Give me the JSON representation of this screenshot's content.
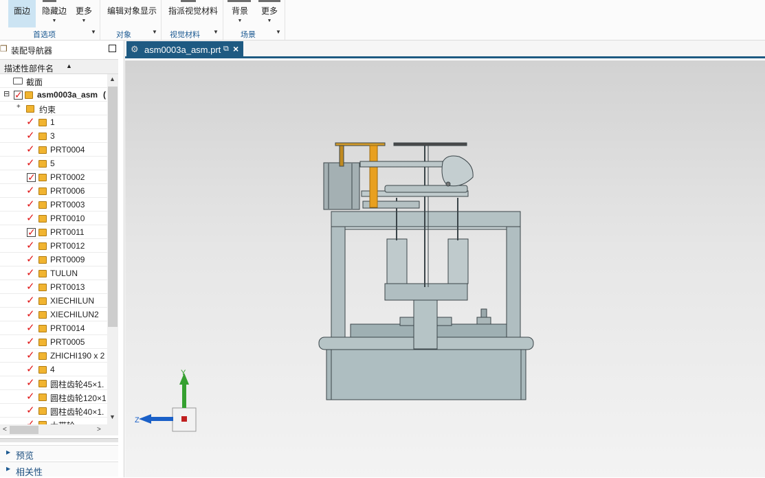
{
  "ribbon": {
    "buttons": {
      "edge": "面边",
      "hide_edge": "隐藏边",
      "more1": "更多",
      "edit_display": "编辑对象显示",
      "assign_material": "指派视觉材料",
      "background": "背景",
      "more2": "更多"
    },
    "groups": {
      "preferences": "首选项",
      "object": "对象",
      "visual_material": "视觉材料",
      "scene": "场景"
    }
  },
  "navigator": {
    "title": "装配导航器",
    "column_header": "描述性部件名",
    "section_label": "截面",
    "root_label": "asm0003a_asm",
    "root_suffix": "(",
    "constraints_label": "约束",
    "parts": [
      "1",
      "3",
      "PRT0004",
      "5",
      "PRT0002",
      "PRT0006",
      "PRT0003",
      "PRT0010",
      "PRT0011",
      "PRT0012",
      "PRT0009",
      "TULUN",
      "PRT0013",
      "XIECHILUN",
      "XIECHILUN2",
      "PRT0014",
      "PRT0005",
      "ZHICHI190 x 2",
      "4",
      "圆柱齿轮45×1.",
      "圆柱齿轮120×1",
      "圆柱齿轮40×1.",
      "大带轮"
    ],
    "panels": {
      "preview": "预览",
      "dependencies": "相关性"
    }
  },
  "graphics": {
    "tab_title": "asm0003a_asm.prt",
    "axes": {
      "y": "Y",
      "z": "Z"
    }
  }
}
